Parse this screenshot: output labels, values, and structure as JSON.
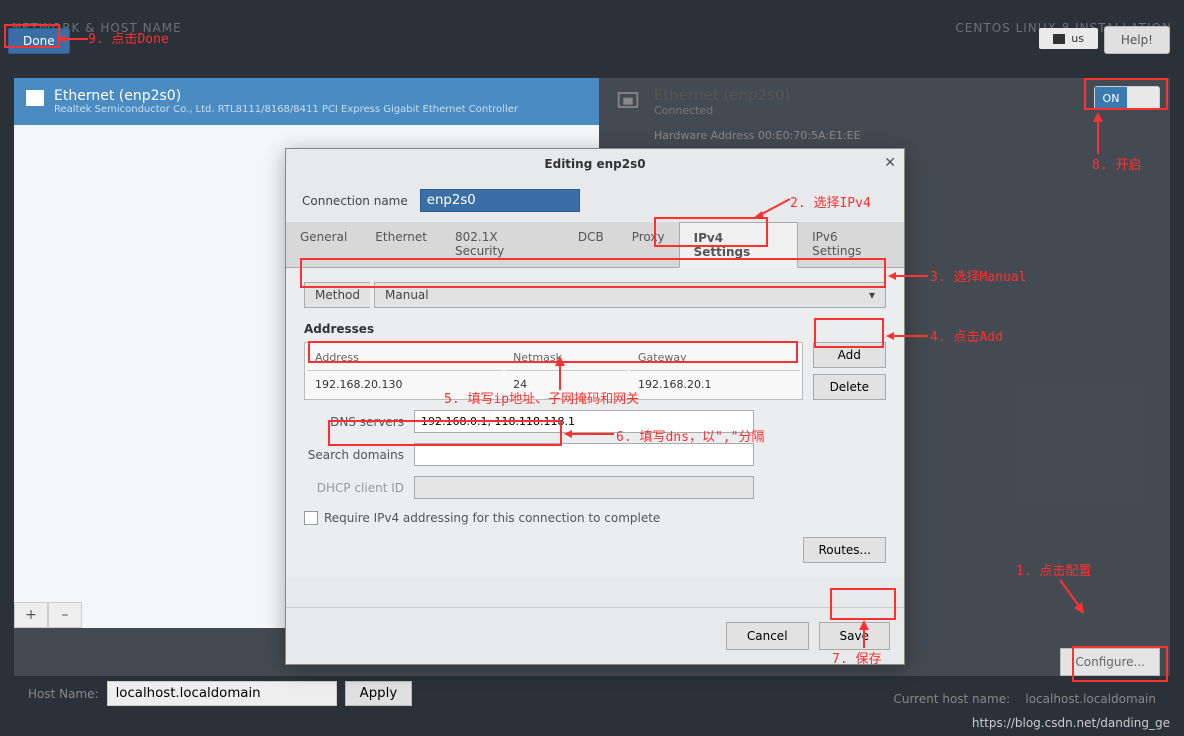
{
  "topbar": {
    "title_left": "NETWORK & HOST NAME",
    "title_right": "CENTOS LINUX 8 INSTALLATION",
    "keyboard": "us",
    "help": "Help!"
  },
  "done_btn": "Done",
  "interface_list": {
    "name": "Ethernet (enp2s0)",
    "desc": "Realtek Semiconductor Co., Ltd. RTL8111/8168/8411 PCI Express Gigabit Ethernet Controller"
  },
  "status": {
    "name": "Ethernet (enp2s0)",
    "state": "Connected",
    "hw": "Hardware Address 00:E0:70:5A:E1:EE",
    "toggle": "ON"
  },
  "plus": "+",
  "minus": "–",
  "configure_btn": "Configure...",
  "hostname": {
    "label": "Host Name:",
    "value": "localhost.localdomain",
    "apply": "Apply",
    "current_label": "Current host name:",
    "current_value": "localhost.localdomain"
  },
  "dialog": {
    "title": "Editing enp2s0",
    "conn_label": "Connection name",
    "conn_value": "enp2s0",
    "tabs": [
      "General",
      "Ethernet",
      "802.1X Security",
      "DCB",
      "Proxy",
      "IPv4 Settings",
      "IPv6 Settings"
    ],
    "active_tab": "IPv4 Settings",
    "method_label": "Method",
    "method_value": "Manual",
    "addresses_label": "Addresses",
    "addr_headers": [
      "Address",
      "Netmask",
      "Gateway"
    ],
    "addr_row": {
      "address": "192.168.20.130",
      "netmask": "24",
      "gateway": "192.168.20.1"
    },
    "add_btn": "Add",
    "delete_btn": "Delete",
    "dns_label": "DNS servers",
    "dns_value": "192.168.0.1, 118.118.118.1",
    "search_label": "Search domains",
    "search_value": "",
    "dhcp_label": "DHCP client ID",
    "dhcp_value": "",
    "require_chk": "Require IPv4 addressing for this connection to complete",
    "routes_btn": "Routes...",
    "cancel_btn": "Cancel",
    "save_btn": "Save"
  },
  "annotations": {
    "a1": "1. 点击配置",
    "a2": "2. 选择IPv4",
    "a3": "3. 选择Manual",
    "a4": "4. 点击Add",
    "a5": "5. 填写ip地址、子网掩码和网关",
    "a6": "6. 填写dns，以\",\"分隔",
    "a7": "7. 保存",
    "a8": "8. 开启",
    "a9": "9. 点击Done"
  },
  "watermark": "https://blog.csdn.net/danding_ge"
}
